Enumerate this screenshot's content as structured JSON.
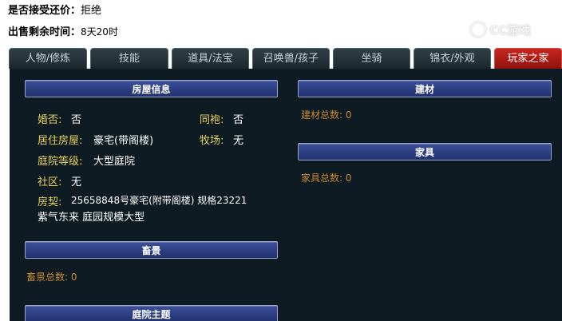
{
  "header": {
    "counter_offer_label": "是否接受还价：",
    "counter_offer_value": "拒绝",
    "remaining_label": "出售剩余时间：",
    "remaining_value": "8天20时"
  },
  "watermark": {
    "text": "CC游戏"
  },
  "tabs": [
    {
      "label": "人物/修炼",
      "active": false
    },
    {
      "label": "技能",
      "active": false
    },
    {
      "label": "道具/法宝",
      "active": false
    },
    {
      "label": "召唤兽/孩子",
      "active": false
    },
    {
      "label": "坐骑",
      "active": false
    },
    {
      "label": "锦衣/外观",
      "active": false
    },
    {
      "label": "玩家之家",
      "active": true
    }
  ],
  "house": {
    "title": "房屋信息",
    "married_label": "婚否:",
    "married_value": "否",
    "robe_label": "同袍:",
    "robe_value": "否",
    "residence_label": "居住房屋:",
    "residence_value": "豪宅(带阁楼)",
    "ranch_label": "牧场:",
    "ranch_value": "无",
    "yard_label": "庭院等级:",
    "yard_value": "大型庭院",
    "community_label": "社区:",
    "community_value": "无",
    "deed_label": "房契:",
    "deed_line1": "25658848号豪宅(附带阁楼) 规格23221",
    "deed_line2": "紫气东来 庭园规模大型"
  },
  "livestock": {
    "title": "畜景",
    "total": "畜景总数: 0"
  },
  "courtyard_theme": {
    "title": "庭院主题"
  },
  "materials": {
    "title": "建材",
    "total": "建材总数: 0"
  },
  "furniture": {
    "title": "家具",
    "total": "家具总数: 0"
  },
  "colors": {
    "panel_bg": "#0e1b23",
    "label_yellow": "#e8d25a",
    "orange": "#c98a30",
    "tab_active": "#c8261e",
    "header_blue": "#2b3c80"
  }
}
